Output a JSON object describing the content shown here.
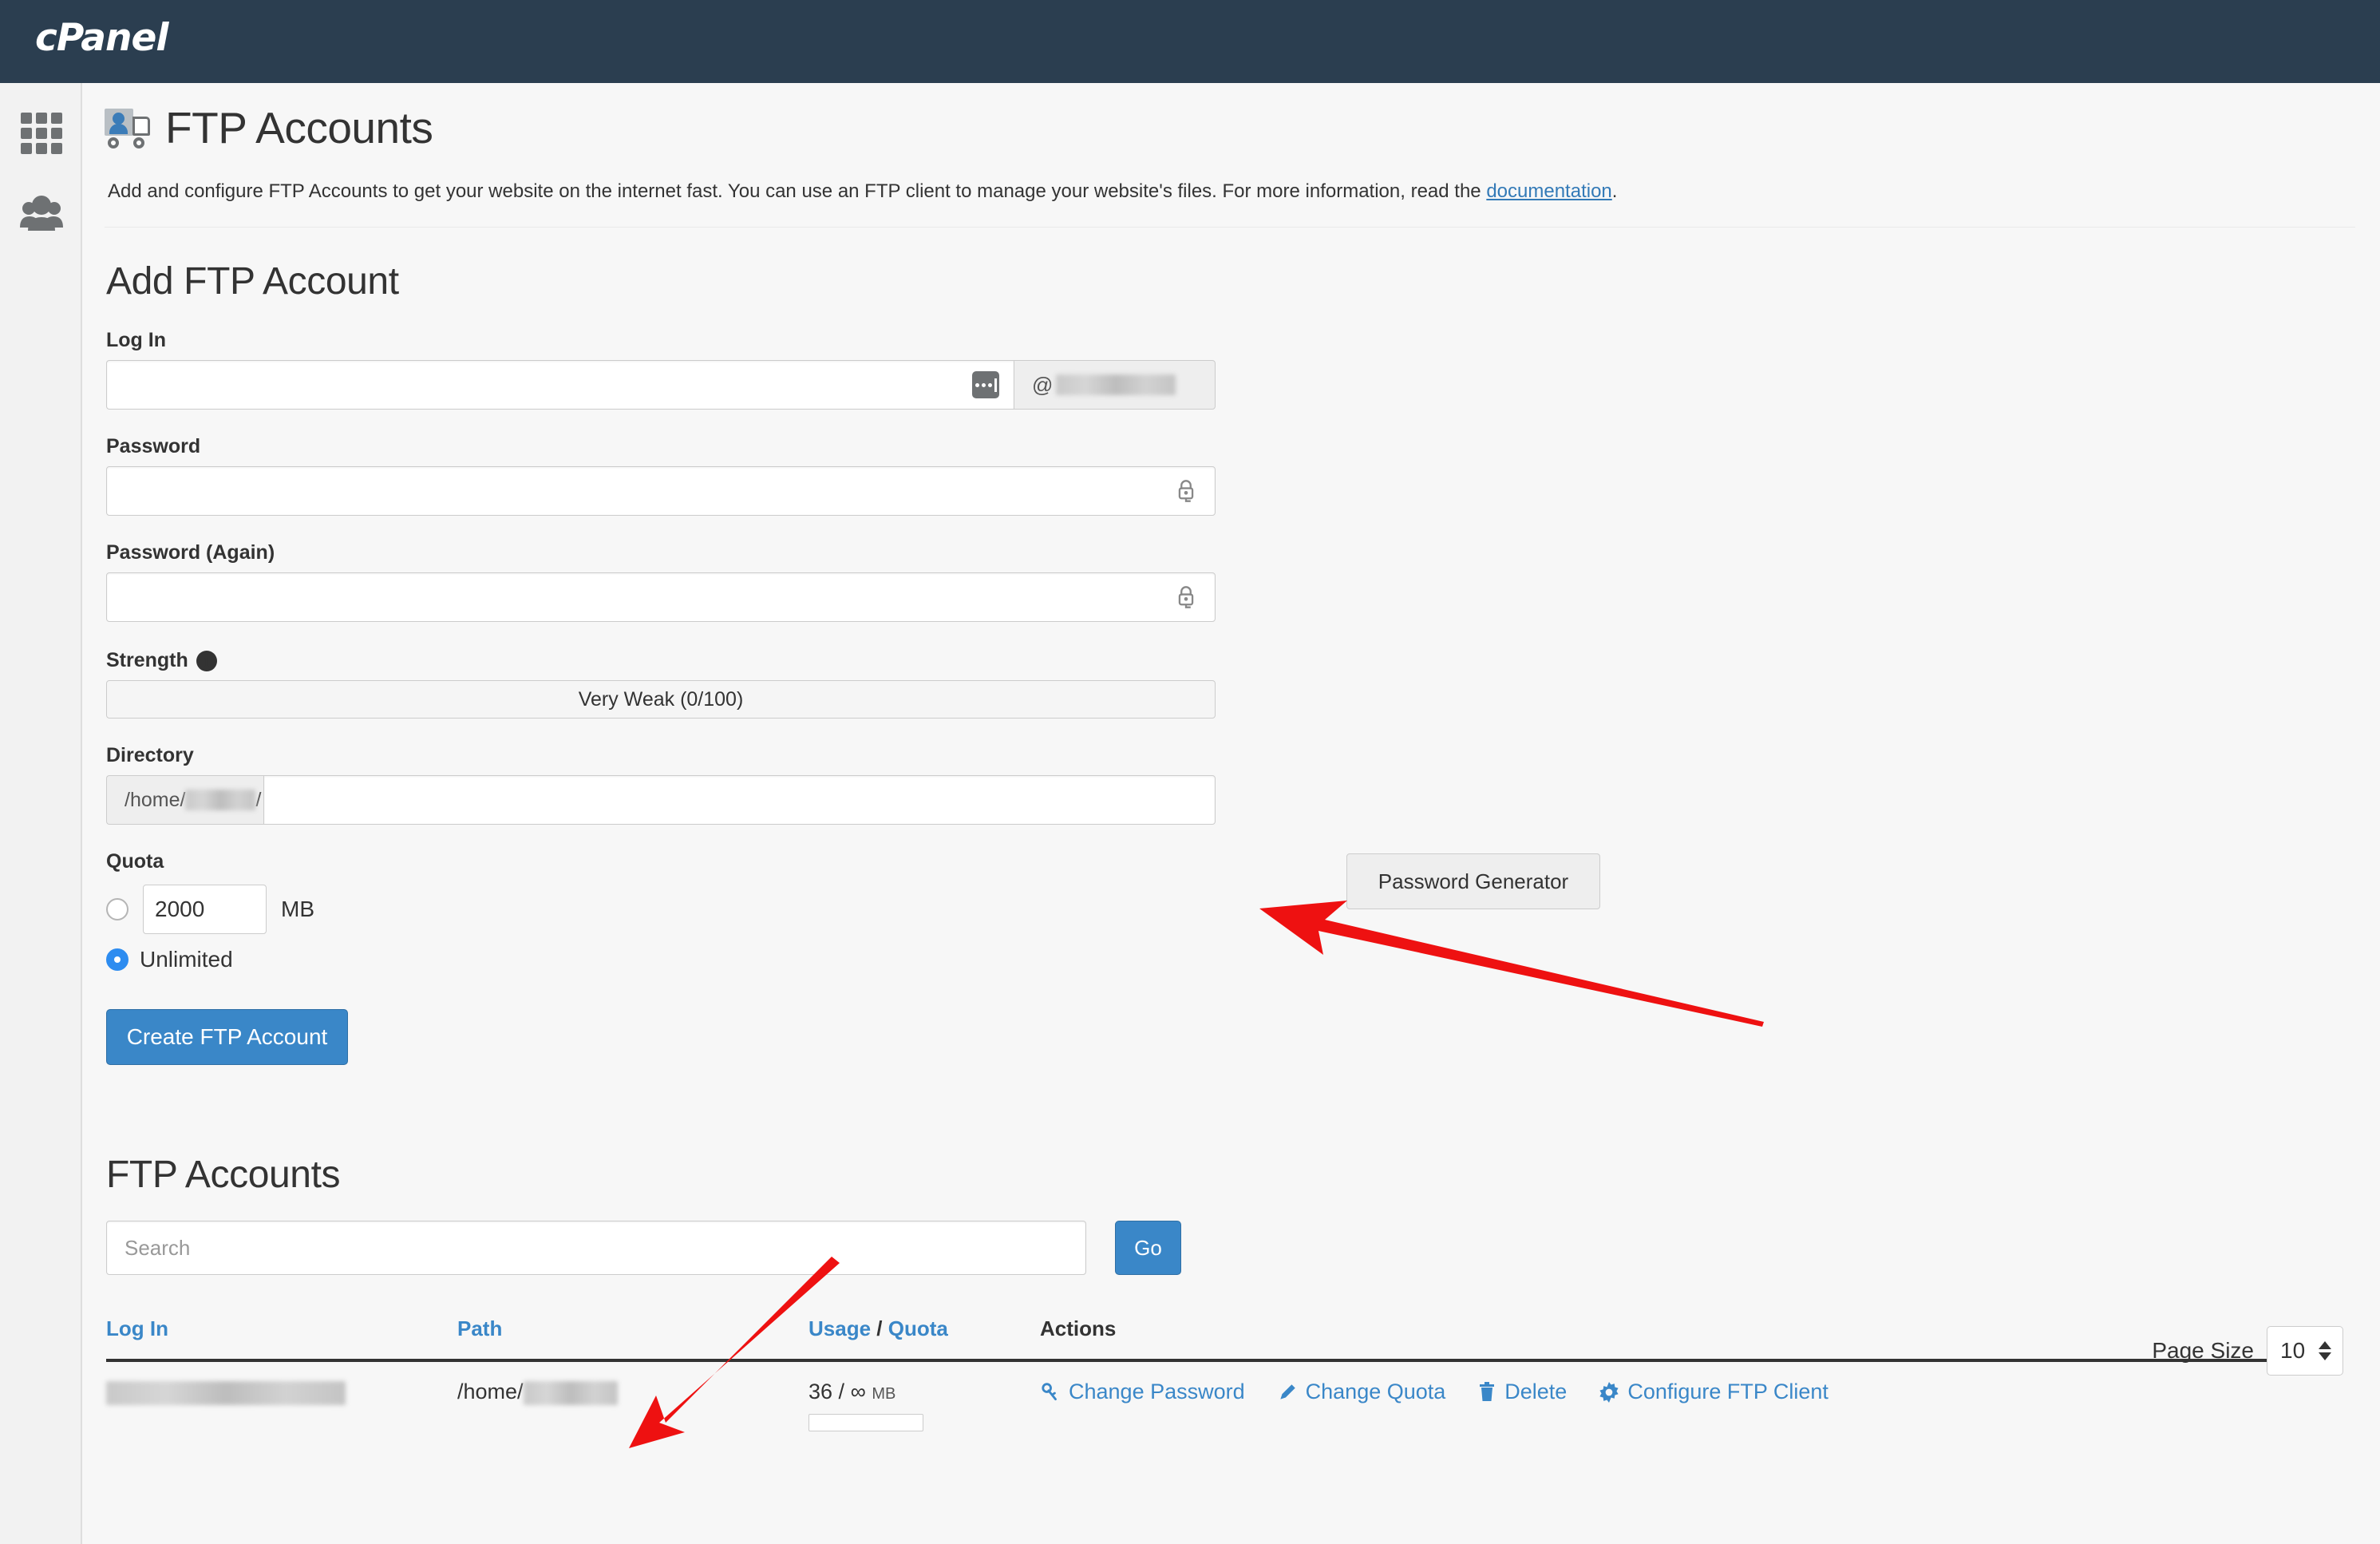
{
  "brand": {
    "name": "cPanel"
  },
  "sidebar": {
    "items": [
      {
        "name": "apps-grid",
        "label": "Apps"
      },
      {
        "name": "users",
        "label": "Users"
      }
    ]
  },
  "page": {
    "title": "FTP Accounts",
    "description_before": "Add and configure FTP Accounts to get your website on the internet fast. You can use an FTP client to manage your website's files. For more information, read the ",
    "documentation_link": "documentation",
    "description_after": "."
  },
  "add_form": {
    "heading": "Add FTP Account",
    "login_label": "Log In",
    "login_value": "",
    "login_domain_prefix": "@",
    "password_label": "Password",
    "password_value": "",
    "password_again_label": "Password (Again)",
    "password_again_value": "",
    "strength_label": "Strength",
    "strength_text": "Very Weak (0/100)",
    "password_generator_label": "Password Generator",
    "directory_label": "Directory",
    "directory_prefix_start": "/home/",
    "directory_prefix_end": "/",
    "directory_value": "",
    "quota_label": "Quota",
    "quota_value": "2000",
    "quota_unit": "MB",
    "quota_unlimited_label": "Unlimited",
    "quota_selected": "unlimited",
    "create_button": "Create FTP Account"
  },
  "list": {
    "heading": "FTP Accounts",
    "search_placeholder": "Search",
    "search_value": "",
    "go_button": "Go",
    "page_size_label": "Page Size",
    "page_size_value": "10",
    "columns": {
      "login": "Log In",
      "path": "Path",
      "usage": "Usage",
      "usage_sep": " / ",
      "quota": "Quota",
      "actions": "Actions"
    },
    "rows": [
      {
        "login": "",
        "path_prefix": "/home/",
        "path_value": "",
        "usage": "36",
        "usage_sep": " / ",
        "quota": "∞",
        "unit": "MB",
        "actions": [
          {
            "icon": "key-icon",
            "label": "Change Password"
          },
          {
            "icon": "pencil-icon",
            "label": "Change Quota"
          },
          {
            "icon": "trash-icon",
            "label": "Delete"
          },
          {
            "icon": "gear-icon",
            "label": "Configure FTP Client"
          }
        ]
      }
    ]
  },
  "annotations": {
    "arrow_color": "#ee1111",
    "arrows": [
      {
        "name": "arrow-to-directory-field"
      },
      {
        "name": "arrow-to-path-column"
      }
    ]
  },
  "colors": {
    "header_bg": "#2b3e50",
    "accent_blue": "#3a87c8",
    "link_blue": "#337ab7",
    "radio_selected": "#2d8cf0"
  }
}
